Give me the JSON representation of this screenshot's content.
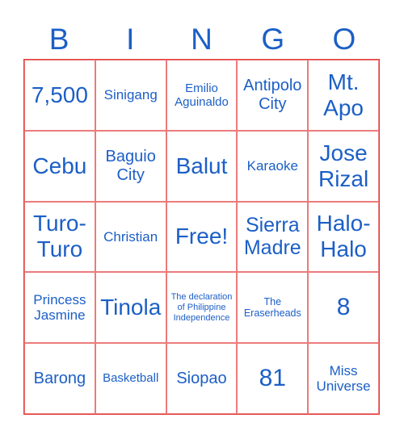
{
  "header": [
    "B",
    "I",
    "N",
    "G",
    "O"
  ],
  "cells": [
    [
      "7,500",
      "Sinigang",
      "Emilio Aguinaldo",
      "Antipolo City",
      "Mt. Apo"
    ],
    [
      "Cebu",
      "Baguio City",
      "Balut",
      "Karaoke",
      "Jose Rizal"
    ],
    [
      "Turo-Turo",
      "Christian",
      "Free!",
      "Sierra Madre",
      "Halo-Halo"
    ],
    [
      "Princess Jasmine",
      "Tinola",
      "The declaration of Philippine Independence",
      "The Eraserheads",
      "8"
    ],
    [
      "Barong",
      "Basketball",
      "Siopao",
      "81",
      "Miss Universe"
    ]
  ],
  "colors": {
    "text": "#1c5fc6",
    "border": "#e53a3a"
  }
}
